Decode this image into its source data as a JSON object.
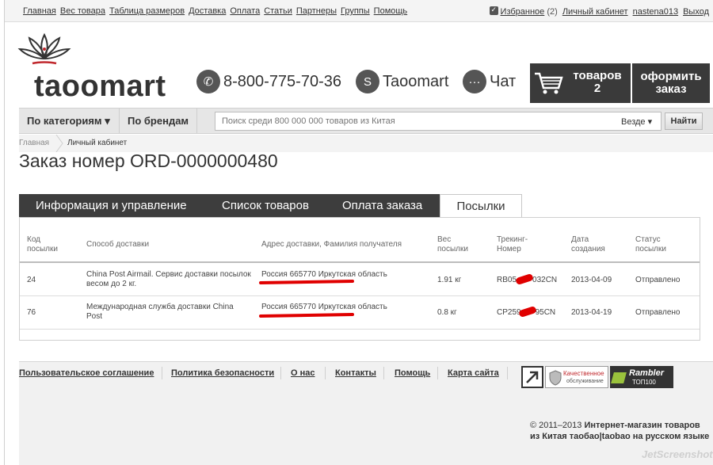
{
  "topbar": {
    "nav": [
      "Главная",
      "Вес товара",
      "Таблица размеров",
      "Доставка",
      "Оплата",
      "Статьи",
      "Партнеры",
      "Группы",
      "Помощь"
    ],
    "favorites_label": "Избранное",
    "favorites_count": "(2)",
    "account_link": "Личный кабинет",
    "username": "nastena013",
    "logout": "Выход"
  },
  "header": {
    "logo_text": "taoomart",
    "phone": "8-800-775-70-36",
    "skype": "Taoomart",
    "chat": "Чат",
    "cart_label": "товаров",
    "cart_count": "2",
    "checkout_line1": "оформить",
    "checkout_line2": "заказ"
  },
  "navbar": {
    "categories": "По категориям",
    "brands": "По брендам",
    "search_placeholder": "Поиск среди 800 000 000 товаров из Китая",
    "search_scope": "Везде",
    "search_button": "Найти"
  },
  "breadcrumb": {
    "home": "Главная",
    "current": "Личный кабинет"
  },
  "page_title": "Заказ номер ORD-0000000480",
  "tabs": {
    "info": "Информация и управление",
    "items": "Список товаров",
    "payment": "Оплата заказа",
    "parcels": "Посылки"
  },
  "table": {
    "headers": {
      "code": [
        "Код",
        "посылки"
      ],
      "method": "Способ доставки",
      "address": "Адрес доставки, Фамилия получателя",
      "weight": [
        "Вес",
        "посылки"
      ],
      "tracking": [
        "Трекинг-",
        "Номер"
      ],
      "date": [
        "Дата",
        "создания"
      ],
      "status": [
        "Статус",
        "посылки"
      ]
    },
    "rows": [
      {
        "code": "24",
        "method": [
          "China Post Airmail. Сервис доставки посылок",
          "весом до 2 кг."
        ],
        "address": "Россия 665770 Иркутская область",
        "weight": "1.91 кг",
        "tracking_start": "RB05",
        "tracking_end": "032CN",
        "date": "2013-04-09",
        "status": "Отправлено"
      },
      {
        "code": "76",
        "method": [
          "Международная служба доставки China",
          "Post"
        ],
        "address": "Россия 665770 Иркутская область",
        "weight": "0.8 кг",
        "tracking_start": "CP259",
        "tracking_end": "95CN",
        "date": "2013-04-19",
        "status": "Отправлено"
      }
    ]
  },
  "footer": {
    "links": [
      "Пользовательское соглашение",
      "Политика безопасности",
      "О нас",
      "Контакты",
      "Помощь",
      "Карта сайта"
    ],
    "badge_quality_line1": "Качественное",
    "badge_quality_line2": "обслуживание",
    "badge_rambler_line1": "Rambler",
    "badge_rambler_line2": "ТОП100",
    "copyright_prefix": "© 2011–2013 ",
    "copyright_bold1": "Интернет-магазин товаров",
    "copyright_bold2": "из Китая таобао|taobao на русском языке",
    "watermark": "JetScreenshot"
  },
  "colors": {
    "dark_panel": "#3a3a3a",
    "redaction": "#e00000"
  }
}
